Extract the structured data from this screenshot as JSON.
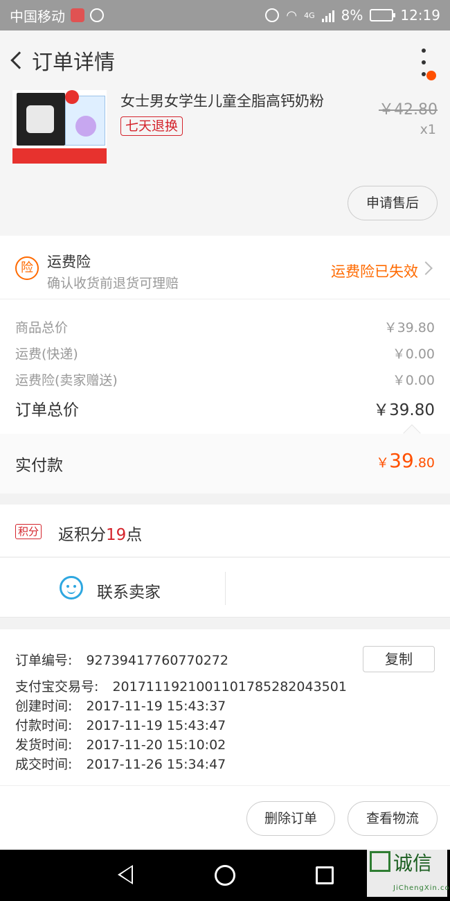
{
  "status_bar": {
    "carrier": "中国移动",
    "battery": "8%",
    "time": "12:19",
    "net": "4G"
  },
  "header": {
    "title": "订单详情"
  },
  "product": {
    "name": "女士男女学生儿童全脂高钙奶粉",
    "return_badge": "七天退换",
    "original_price": "￥42.80",
    "quantity": "x1",
    "after_sale_button": "申请售后"
  },
  "insurance": {
    "icon_char": "险",
    "title": "运费险",
    "desc": "确认收货前退货可理赔",
    "status": "运费险已失效"
  },
  "prices": {
    "goods_label": "商品总价",
    "goods_value": "￥39.80",
    "shipping_label": "运费(快递)",
    "shipping_value": "￥0.00",
    "insurance_label": "运费险(卖家赠送)",
    "insurance_value": "￥0.00",
    "total_label": "订单总价",
    "total_value": "￥39.80"
  },
  "paid": {
    "label": "实付款",
    "currency": "￥",
    "integer": "39",
    "decimal": ".80"
  },
  "points": {
    "badge": "积分",
    "prefix": "返积分",
    "count": "19",
    "suffix": "点"
  },
  "contact": {
    "label": "联系卖家"
  },
  "order_info": {
    "order_no_label": "订单编号:",
    "order_no": "92739417760770272",
    "copy_button": "复制",
    "alipay_label": "支付宝交易号:",
    "alipay_no": "2017111921001101785282043501",
    "created_label": "创建时间:",
    "created": "2017-11-19 15:43:37",
    "paid_label": "付款时间:",
    "paid": "2017-11-19 15:43:47",
    "shipped_label": "发货时间:",
    "shipped": "2017-11-20 15:10:02",
    "done_label": "成交时间:",
    "done": "2017-11-26 15:34:47"
  },
  "actions": {
    "delete_button": "删除订单",
    "logistics_button": "查看物流"
  },
  "watermark": {
    "text": "诚信",
    "sub": "JiChengXin.com"
  },
  "colors": {
    "accent_orange": "#ff5000",
    "badge_red": "#d4232b",
    "chat_blue": "#2ea7e0"
  }
}
